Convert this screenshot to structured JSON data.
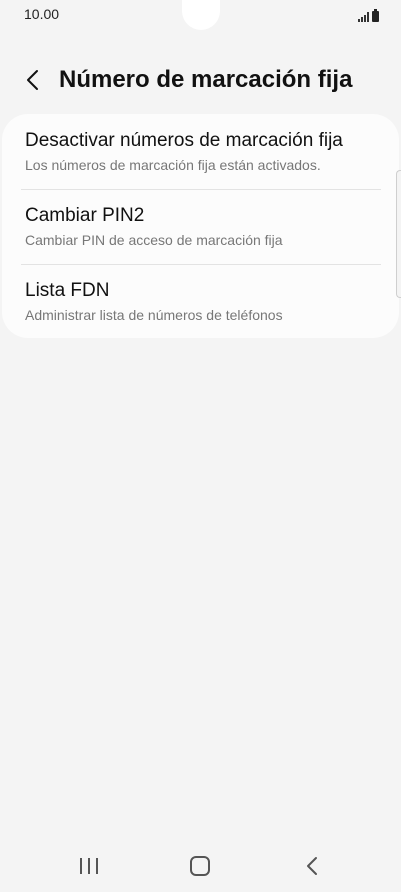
{
  "status_bar": {
    "time": "10.00"
  },
  "header": {
    "back_icon": "chevron-left-icon",
    "title": "Número de marcación fija"
  },
  "menu": {
    "items": [
      {
        "title": "Desactivar números de marcación fija",
        "subtitle": "Los números de marcación fija están activados."
      },
      {
        "title": "Cambiar PIN2",
        "subtitle": "Cambiar PIN de acceso de marcación fija"
      },
      {
        "title": "Lista FDN",
        "subtitle": "Administrar lista de números de teléfonos"
      }
    ]
  },
  "nav_bar": {
    "recent_icon": "recent-apps-icon",
    "home_icon": "home-icon",
    "back_icon": "back-icon"
  },
  "colors": {
    "background": "#f4f4f4",
    "card": "#fcfcfc",
    "title_text": "#111111",
    "subtitle_text": "#777777"
  }
}
